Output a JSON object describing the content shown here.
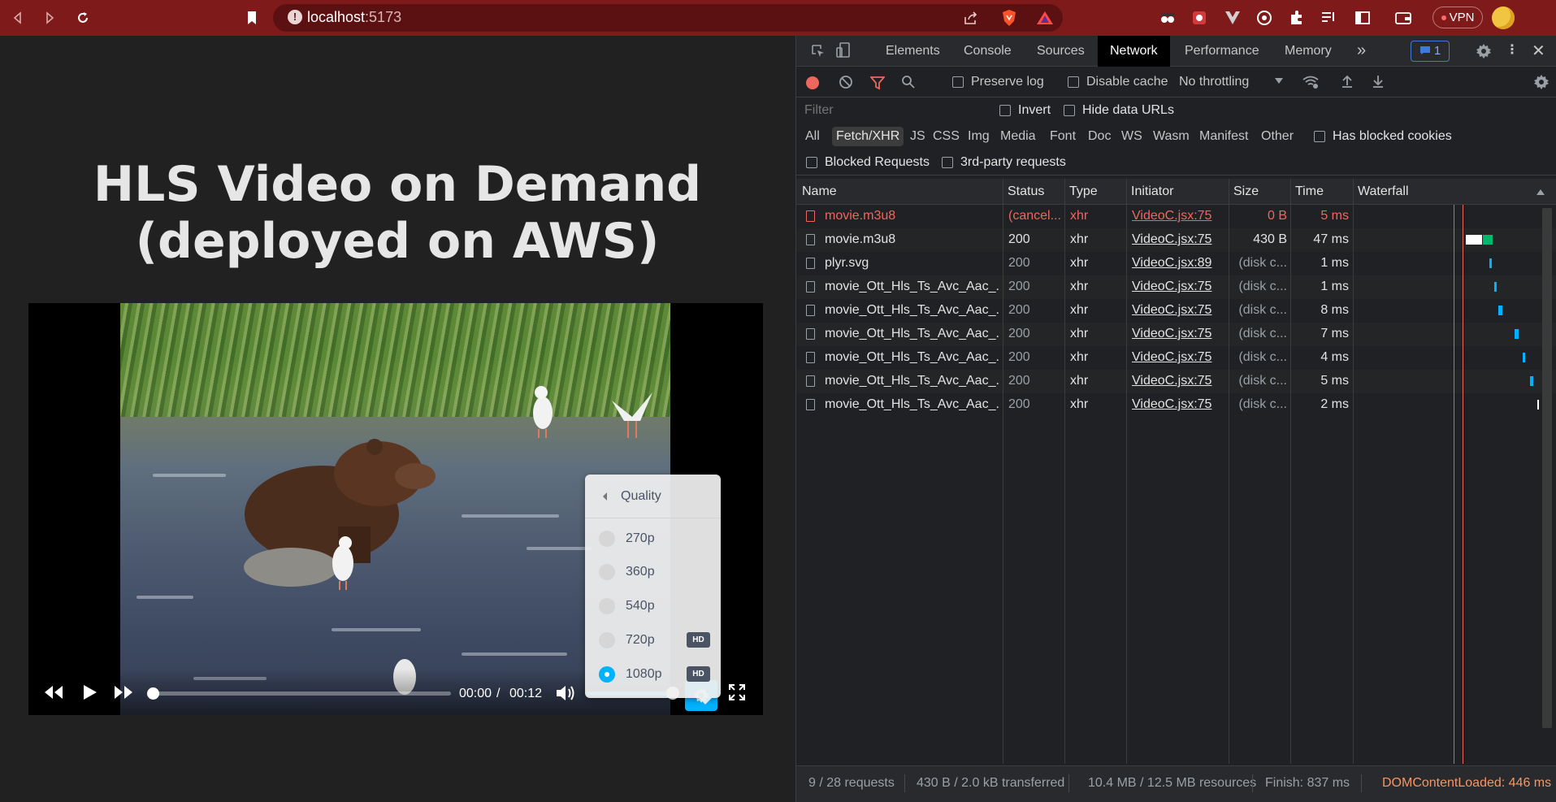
{
  "browser": {
    "url_host": "localhost",
    "url_port": ":5173",
    "vpn_label": "VPN"
  },
  "page": {
    "title_line1": "HLS Video on Demand",
    "title_line2": "(deployed on AWS)"
  },
  "player": {
    "current_time": "00:00",
    "separator": "/",
    "duration": "00:12",
    "progress": 0,
    "volume": 1,
    "quality_menu": {
      "title": "Quality",
      "options": [
        {
          "label": "270p",
          "badge": "",
          "selected": false
        },
        {
          "label": "360p",
          "badge": "",
          "selected": false
        },
        {
          "label": "540p",
          "badge": "",
          "selected": false
        },
        {
          "label": "720p",
          "badge": "HD",
          "selected": false
        },
        {
          "label": "1080p",
          "badge": "HD",
          "selected": true
        }
      ]
    }
  },
  "devtools": {
    "tabs": [
      "Elements",
      "Console",
      "Sources",
      "Network",
      "Performance",
      "Memory"
    ],
    "active_tab": "Network",
    "issues_count": "1",
    "toolbar": {
      "preserve_log": "Preserve log",
      "disable_cache": "Disable cache",
      "throttling": "No throttling"
    },
    "filter": {
      "placeholder": "Filter",
      "invert": "Invert",
      "hide_data_urls": "Hide data URLs"
    },
    "types": [
      "All",
      "Fetch/XHR",
      "JS",
      "CSS",
      "Img",
      "Media",
      "Font",
      "Doc",
      "WS",
      "Wasm",
      "Manifest",
      "Other"
    ],
    "active_type": "Fetch/XHR",
    "has_blocked_cookies": "Has blocked cookies",
    "blocked_requests": "Blocked Requests",
    "third_party": "3rd-party requests",
    "columns": [
      "Name",
      "Status",
      "Type",
      "Initiator",
      "Size",
      "Time",
      "Waterfall"
    ],
    "rows": [
      {
        "name": "movie.m3u8",
        "status": "(cancel...",
        "type": "xhr",
        "initiator": "VideoC.jsx:75",
        "size": "0 B",
        "time": "5 ms",
        "error": true
      },
      {
        "name": "movie.m3u8",
        "status": "200",
        "type": "xhr",
        "initiator": "VideoC.jsx:75",
        "size": "430 B",
        "time": "47 ms",
        "error": false
      },
      {
        "name": "plyr.svg",
        "status": "200",
        "type": "xhr",
        "initiator": "VideoC.jsx:89",
        "size": "(disk c...",
        "time": "1 ms",
        "error": false
      },
      {
        "name": "movie_Ott_Hls_Ts_Avc_Aac_...",
        "status": "200",
        "type": "xhr",
        "initiator": "VideoC.jsx:75",
        "size": "(disk c...",
        "time": "1 ms",
        "error": false
      },
      {
        "name": "movie_Ott_Hls_Ts_Avc_Aac_...",
        "status": "200",
        "type": "xhr",
        "initiator": "VideoC.jsx:75",
        "size": "(disk c...",
        "time": "8 ms",
        "error": false
      },
      {
        "name": "movie_Ott_Hls_Ts_Avc_Aac_...",
        "status": "200",
        "type": "xhr",
        "initiator": "VideoC.jsx:75",
        "size": "(disk c...",
        "time": "7 ms",
        "error": false
      },
      {
        "name": "movie_Ott_Hls_Ts_Avc_Aac_...",
        "status": "200",
        "type": "xhr",
        "initiator": "VideoC.jsx:75",
        "size": "(disk c...",
        "time": "4 ms",
        "error": false
      },
      {
        "name": "movie_Ott_Hls_Ts_Avc_Aac_...",
        "status": "200",
        "type": "xhr",
        "initiator": "VideoC.jsx:75",
        "size": "(disk c...",
        "time": "5 ms",
        "error": false
      },
      {
        "name": "movie_Ott_Hls_Ts_Avc_Aac_...",
        "status": "200",
        "type": "xhr",
        "initiator": "VideoC.jsx:75",
        "size": "(disk c...",
        "time": "2 ms",
        "error": false
      }
    ],
    "status_bar": {
      "requests": "9 / 28 requests",
      "transferred": "430 B / 2.0 kB transferred",
      "resources": "10.4 MB / 12.5 MB resources",
      "finish": "Finish: 837 ms",
      "dom_content_loaded": "DOMContentLoaded: 446 ms"
    },
    "colors": {
      "dom_content_loaded": "#f29766",
      "error": "#ee675c",
      "accent": "#00b2ff"
    }
  }
}
